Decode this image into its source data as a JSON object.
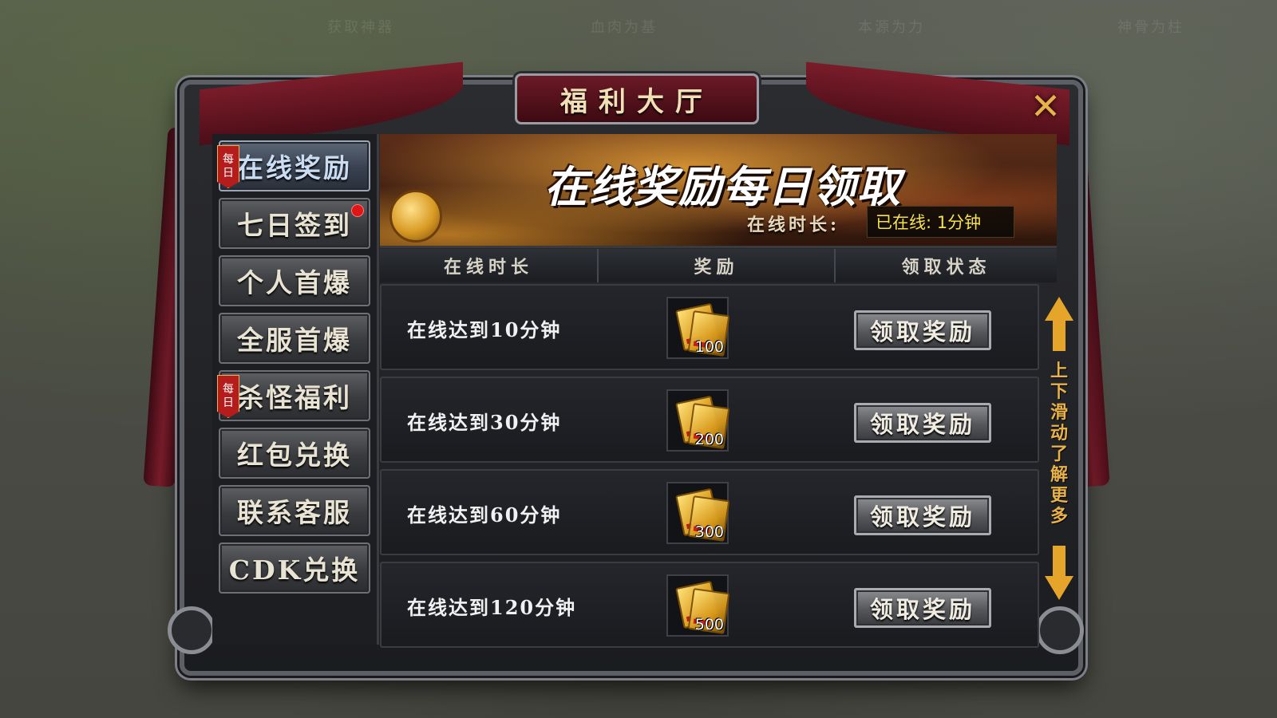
{
  "background_labels": [
    "获取神器",
    "血肉为基",
    "本源为力",
    "神骨为柱"
  ],
  "title": "福利大厅",
  "nav_items": [
    {
      "label": "在线奖励",
      "badge": "每日",
      "active": true,
      "dot": false
    },
    {
      "label": "七日签到",
      "badge": "",
      "active": false,
      "dot": true
    },
    {
      "label": "个人首爆",
      "badge": "",
      "active": false,
      "dot": false
    },
    {
      "label": "全服首爆",
      "badge": "",
      "active": false,
      "dot": false
    },
    {
      "label": "杀怪福利",
      "badge": "每日",
      "active": false,
      "dot": false
    },
    {
      "label": "红包兑换",
      "badge": "",
      "active": false,
      "dot": false
    },
    {
      "label": "联系客服",
      "badge": "",
      "active": false,
      "dot": false
    },
    {
      "label": "CDK兑换",
      "badge": "",
      "active": false,
      "dot": false
    }
  ],
  "banner": {
    "title": "在线奖励每日领取",
    "online_label": "在线时长:",
    "online_value": "已在线: 1分钟"
  },
  "table": {
    "headers": [
      "在线时长",
      "奖励",
      "领取状态"
    ],
    "rows": [
      {
        "condition": "在线达到10分钟",
        "reward_qty": "100",
        "button": "领取奖励"
      },
      {
        "condition": "在线达到30分钟",
        "reward_qty": "200",
        "button": "领取奖励"
      },
      {
        "condition": "在线达到60分钟",
        "reward_qty": "300",
        "button": "领取奖励"
      },
      {
        "condition": "在线达到120分钟",
        "reward_qty": "500",
        "button": "领取奖励"
      }
    ]
  },
  "scroll_hint": "上下滑动了解更多",
  "icons": {
    "close": "close-icon",
    "reward": "gold-ticket-icon",
    "scroll_up": "arrow-up-icon",
    "scroll_down": "arrow-down-icon"
  },
  "colors": {
    "accent_gold": "#e5a52a",
    "online_value": "#f5e24a",
    "drape_red": "#7a1c2a"
  }
}
